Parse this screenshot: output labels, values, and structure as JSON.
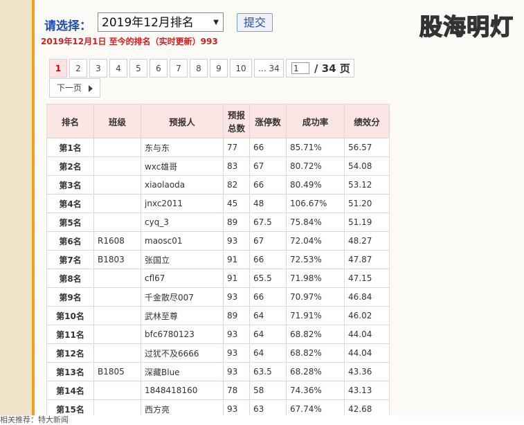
{
  "selector": {
    "label": "请选择：",
    "selected": "2019年12月排名",
    "submit": "提交"
  },
  "watermark": "股海明灯",
  "update_line": "2019年12月1日 至今的排名（实时更新）993",
  "pager": {
    "pages": [
      "1",
      "2",
      "3",
      "4",
      "5",
      "6",
      "7",
      "8",
      "9",
      "10",
      "... 34"
    ],
    "current_input": "1",
    "total": "/ 34 页",
    "next": "下一页"
  },
  "table": {
    "headers": [
      "排名",
      "班级",
      "预报人",
      "预报总数",
      "涨停数",
      "成功率",
      "绩效分"
    ],
    "rows": [
      [
        "第1名",
        "",
        "东与东",
        "77",
        "66",
        "85.71%",
        "56.57"
      ],
      [
        "第2名",
        "",
        "wxc雄哥",
        "83",
        "67",
        "80.72%",
        "54.08"
      ],
      [
        "第3名",
        "",
        "xiaolaoda",
        "82",
        "66",
        "80.49%",
        "53.12"
      ],
      [
        "第4名",
        "",
        "jnxc2011",
        "45",
        "48",
        "106.67%",
        "51.20"
      ],
      [
        "第5名",
        "",
        "cyq_3",
        "89",
        "67.5",
        "75.84%",
        "51.19"
      ],
      [
        "第6名",
        "R1608",
        "maosc01",
        "93",
        "67",
        "72.04%",
        "48.27"
      ],
      [
        "第7名",
        "B1803",
        "张国立",
        "91",
        "66",
        "72.53%",
        "47.87"
      ],
      [
        "第8名",
        "",
        "cfl67",
        "91",
        "65.5",
        "71.98%",
        "47.15"
      ],
      [
        "第9名",
        "",
        "千金散尽007",
        "93",
        "66",
        "70.97%",
        "46.84"
      ],
      [
        "第10名",
        "",
        "武林至尊",
        "89",
        "64",
        "71.91%",
        "46.02"
      ],
      [
        "第11名",
        "",
        "bfc6780123",
        "93",
        "64",
        "68.82%",
        "44.04"
      ],
      [
        "第12名",
        "",
        "过犹不及6666",
        "93",
        "64",
        "68.82%",
        "44.04"
      ],
      [
        "第13名",
        "B1805",
        "深藏Blue",
        "93",
        "63.5",
        "68.28%",
        "43.36"
      ],
      [
        "第14名",
        "",
        "1848418160",
        "78",
        "58",
        "74.36%",
        "43.13"
      ],
      [
        "第15名",
        "",
        "西方亮",
        "93",
        "63",
        "67.74%",
        "42.68"
      ]
    ]
  },
  "footer": "相关推荐：特大新闻"
}
